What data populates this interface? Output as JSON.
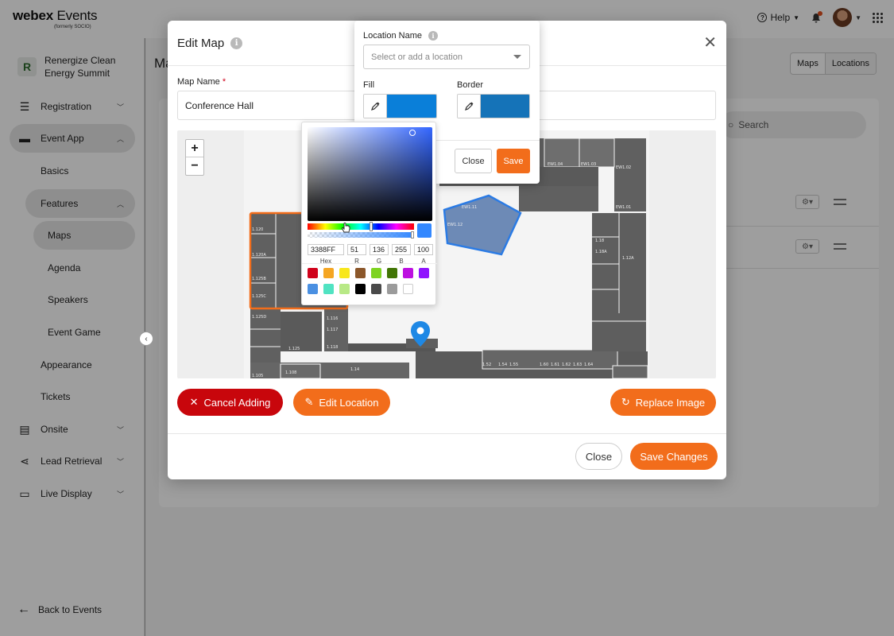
{
  "brand": {
    "name_bold": "webex",
    "name_rest": " Events",
    "sub": "(formerly SOCIO)"
  },
  "topbar": {
    "help_label": "Help"
  },
  "org": {
    "name": "Renergize Clean Energy Summit",
    "logo_letter": "R"
  },
  "nav": {
    "registration": "Registration",
    "event_app": "Event App",
    "basics": "Basics",
    "features": "Features",
    "maps": "Maps",
    "agenda": "Agenda",
    "speakers": "Speakers",
    "event_game": "Event Game",
    "appearance": "Appearance",
    "tickets": "Tickets",
    "onsite": "Onsite",
    "lead_retrieval": "Lead Retrieval",
    "live_display": "Live Display",
    "back": "Back to Events"
  },
  "page": {
    "title_partial": "Ma",
    "seg_maps": "Maps",
    "seg_locations": "Locations",
    "search_placeholder": "Search"
  },
  "modal": {
    "title": "Edit Map",
    "map_name_label": "Map Name",
    "map_name_value": "Conference Hall",
    "cancel_adding": "Cancel Adding",
    "edit_location": "Edit Location",
    "replace_image": "Replace Image",
    "close": "Close",
    "save_changes": "Save Changes"
  },
  "location_popover": {
    "label": "Location Name",
    "placeholder": "Select or add a location",
    "fill_label": "Fill",
    "border_label": "Border",
    "close": "Close",
    "save": "Save",
    "fill_color": "#0a7fd9",
    "border_color": "#1573b8"
  },
  "color_picker": {
    "hex": "3388FF",
    "r": "51",
    "g": "136",
    "b": "255",
    "a": "100",
    "hex_label": "Hex",
    "r_label": "R",
    "g_label": "G",
    "b_label": "B",
    "a_label": "A",
    "presets": [
      "#d0021b",
      "#f5a623",
      "#f8e71c",
      "#8b572a",
      "#7ed321",
      "#417505",
      "#bd10e0",
      "#9013fe",
      "#4a90e2",
      "#50e3c2",
      "#b8e986",
      "#000000",
      "#4a4a4a",
      "#9b9b9b",
      "#ffffff"
    ]
  },
  "floor_plan_labels": [
    "1.120",
    "1.120A",
    "1.125B",
    "1.125C",
    "1.125D",
    "1.116",
    "1.117",
    "1.118",
    "1.125",
    "1.105",
    "1.108",
    "1.14",
    "1.52",
    "1.54",
    "1.55",
    "1.60",
    "1.61",
    "1.62",
    "1.63",
    "1.64",
    "EW1.04",
    "EW1.03",
    "EW1.02",
    "EW1.01",
    "EW1.11",
    "EW1.12",
    "1.18",
    "1.18A",
    "1.12A"
  ],
  "colors": {
    "accent_orange": "#f26d1b",
    "danger_red": "#c8060c",
    "map_selected_blue": "#2b7be4"
  }
}
